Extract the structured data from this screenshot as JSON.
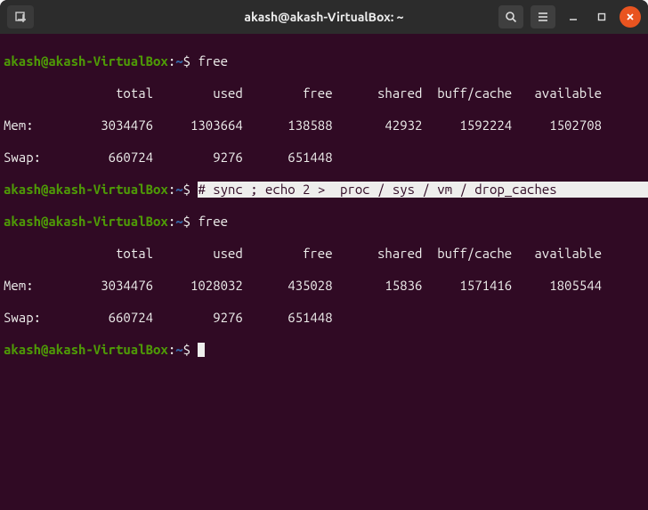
{
  "titlebar": {
    "title": "akash@akash-VirtualBox: ~"
  },
  "prompt": {
    "user_host": "akash@akash-VirtualBox",
    "path": "~",
    "symbol": "$"
  },
  "commands": {
    "free": "free",
    "sync_echo": "# sync ; echo 2 >  proc / sys / vm / drop_caches"
  },
  "free_header": {
    "label": "",
    "total": "total",
    "used": "used",
    "free": "free",
    "shared": "shared",
    "buff_cache": "buff/cache",
    "available": "available"
  },
  "free1": {
    "mem": {
      "label": "Mem:",
      "total": "3034476",
      "used": "1303664",
      "free": "138588",
      "shared": "42932",
      "buff_cache": "1592224",
      "available": "1502708"
    },
    "swap": {
      "label": "Swap:",
      "total": "660724",
      "used": "9276",
      "free": "651448"
    }
  },
  "free2": {
    "mem": {
      "label": "Mem:",
      "total": "3034476",
      "used": "1028032",
      "free": "435028",
      "shared": "15836",
      "buff_cache": "1571416",
      "available": "1805544"
    },
    "swap": {
      "label": "Swap:",
      "total": "660724",
      "used": "9276",
      "free": "651448"
    }
  }
}
